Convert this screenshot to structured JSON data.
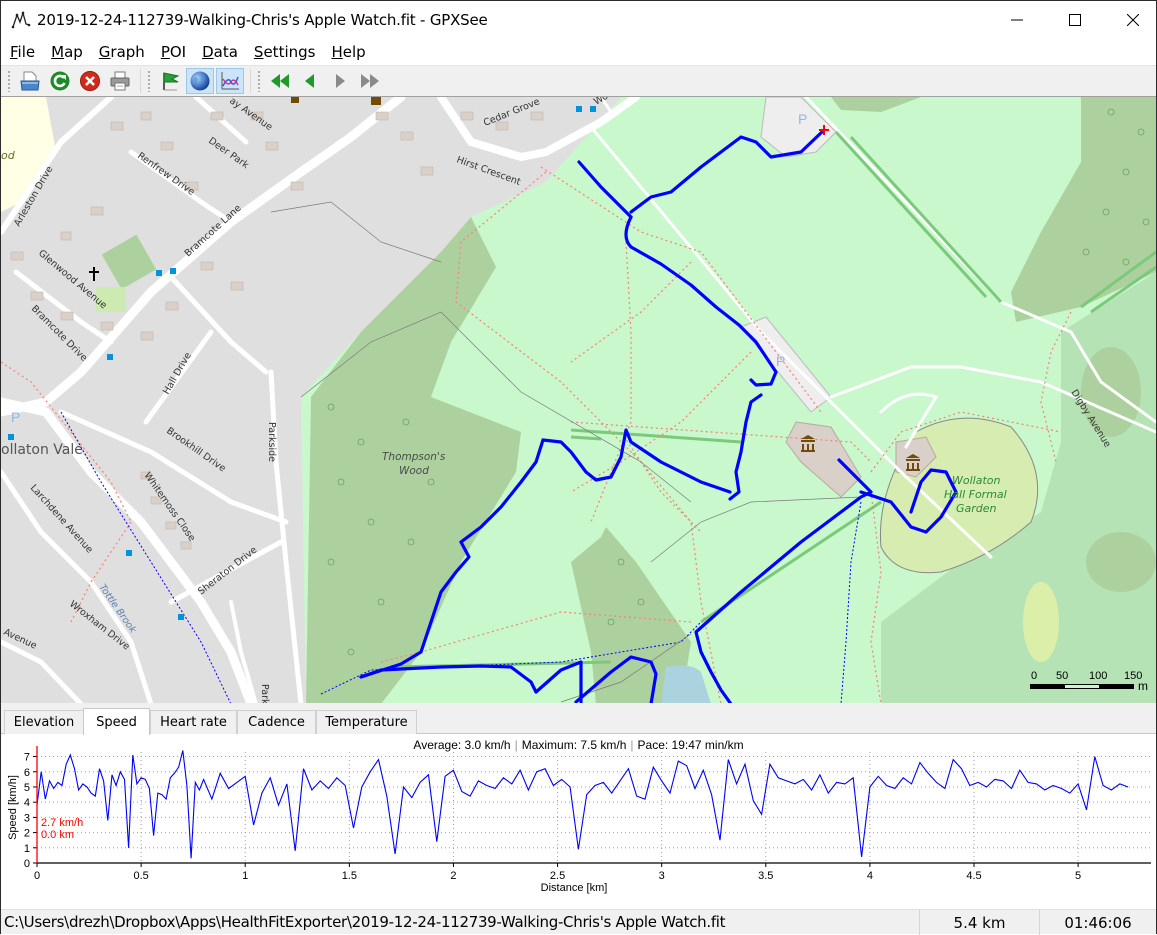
{
  "window": {
    "title": "2019-12-24-112739-Walking-Chris's Apple Watch.fit - GPXSee",
    "app_icon": "gpxsee-track-icon",
    "controls": [
      "minimize",
      "maximize",
      "close"
    ]
  },
  "menu": {
    "items": [
      {
        "label": "File",
        "mnemonic": "F"
      },
      {
        "label": "Map",
        "mnemonic": "M"
      },
      {
        "label": "Graph",
        "mnemonic": "G"
      },
      {
        "label": "POI",
        "mnemonic": "P"
      },
      {
        "label": "Data",
        "mnemonic": "D"
      },
      {
        "label": "Settings",
        "mnemonic": "S"
      },
      {
        "label": "Help",
        "mnemonic": "H"
      }
    ]
  },
  "toolbar": {
    "groups": [
      [
        {
          "name": "open-file",
          "icon": "open-file-icon",
          "checked": false
        },
        {
          "name": "reload",
          "icon": "reload-icon",
          "checked": false
        },
        {
          "name": "close-file",
          "icon": "close-file-icon",
          "checked": false
        },
        {
          "name": "print",
          "icon": "printer-icon",
          "checked": false
        }
      ],
      [
        {
          "name": "show-poi",
          "icon": "flag-icon",
          "checked": false
        },
        {
          "name": "show-map",
          "icon": "globe-icon",
          "checked": true
        },
        {
          "name": "show-graphs",
          "icon": "graph-icon",
          "checked": true
        }
      ],
      [
        {
          "name": "first-file",
          "icon": "first-icon",
          "checked": false,
          "enabled": true
        },
        {
          "name": "previous-file",
          "icon": "previous-icon",
          "checked": false,
          "enabled": true
        },
        {
          "name": "next-file",
          "icon": "next-icon",
          "checked": false,
          "enabled": false
        },
        {
          "name": "last-file",
          "icon": "last-icon",
          "checked": false,
          "enabled": false
        }
      ]
    ]
  },
  "map": {
    "labels": {
      "arleston": "Arleston Drive",
      "renfrew": "Renfrew Drive",
      "deer_park": "Deer Park",
      "ay_avenue": "ay Avenue",
      "bramcote_lane": "Bramcote Lane",
      "glenwood": "Glenwood Avenue",
      "bramcote_drive": "Bramcote Drive",
      "hall_drive": "Hall Drive",
      "wollaton_vale": "ollaton Vale",
      "brookhill": "Brookhill Drive",
      "whitemoss": "Whitemoss Close",
      "parkside": "Parkside",
      "parkside2": "Park",
      "larchdene": "Larchdene Avenue",
      "sheraton": "Sheraton Drive",
      "tottle": "Tottle Brook",
      "wroxham": "Wroxham Drive",
      "avenue_bl": "Avenue",
      "cedar": "Cedar Grove",
      "hirst": "Hirst Crescent",
      "wo": "Wo",
      "thompsons": "Thompson's",
      "wood": "Wood",
      "wollaton_garden_1": "Wollaton",
      "wollaton_garden_2": "Hall Formal",
      "wollaton_garden_3": "Garden",
      "digby": "Digby Avenue",
      "parking": "P",
      "left_partial": "od"
    },
    "scale": {
      "ticks": [
        "0",
        "50",
        "100",
        "150"
      ],
      "unit": "m"
    },
    "track_color": "#0000ff",
    "start_marker_color": "#ff0000"
  },
  "graph_tabs": [
    {
      "label": "Elevation",
      "active": false
    },
    {
      "label": "Speed",
      "active": true
    },
    {
      "label": "Heart rate",
      "active": false
    },
    {
      "label": "Cadence",
      "active": false
    },
    {
      "label": "Temperature",
      "active": false
    }
  ],
  "graph": {
    "info": {
      "average": "Average: 3.0 km/h",
      "maximum": "Maximum: 7.5 km/h",
      "pace": "Pace: 19:47 min/km"
    },
    "slider": {
      "speed": "2.7 km/h",
      "distance": "0.0 km",
      "color": "#ff0000"
    }
  },
  "chart_data": {
    "type": "line",
    "title": "",
    "xlabel": "Distance [km]",
    "ylabel": "Speed [km/h]",
    "xlim": [
      0,
      5.35
    ],
    "ylim": [
      0,
      7.3
    ],
    "x_ticks": [
      "0",
      "0.5",
      "1",
      "1.5",
      "2",
      "2.5",
      "3",
      "3.5",
      "4",
      "4.5",
      "5"
    ],
    "y_ticks": [
      "0",
      "1",
      "2",
      "3",
      "4",
      "5",
      "6",
      "7"
    ],
    "grid": true,
    "series": [
      {
        "name": "Speed",
        "color": "#0000ff",
        "x": [
          0,
          0.02,
          0.04,
          0.06,
          0.08,
          0.1,
          0.12,
          0.14,
          0.16,
          0.18,
          0.2,
          0.22,
          0.24,
          0.26,
          0.28,
          0.3,
          0.32,
          0.34,
          0.36,
          0.38,
          0.4,
          0.42,
          0.44,
          0.46,
          0.48,
          0.5,
          0.52,
          0.54,
          0.56,
          0.58,
          0.6,
          0.62,
          0.64,
          0.66,
          0.68,
          0.7,
          0.72,
          0.74,
          0.76,
          0.78,
          0.8,
          0.84,
          0.88,
          0.92,
          0.96,
          1.0,
          1.04,
          1.08,
          1.12,
          1.16,
          1.2,
          1.24,
          1.28,
          1.32,
          1.36,
          1.4,
          1.44,
          1.48,
          1.52,
          1.56,
          1.6,
          1.64,
          1.68,
          1.72,
          1.76,
          1.8,
          1.84,
          1.88,
          1.92,
          1.96,
          2.0,
          2.04,
          2.08,
          2.12,
          2.16,
          2.2,
          2.24,
          2.28,
          2.32,
          2.36,
          2.4,
          2.44,
          2.48,
          2.52,
          2.56,
          2.6,
          2.64,
          2.68,
          2.72,
          2.76,
          2.8,
          2.84,
          2.88,
          2.92,
          2.96,
          3.0,
          3.04,
          3.08,
          3.12,
          3.16,
          3.2,
          3.24,
          3.28,
          3.32,
          3.36,
          3.4,
          3.44,
          3.48,
          3.52,
          3.56,
          3.6,
          3.64,
          3.68,
          3.72,
          3.76,
          3.8,
          3.84,
          3.88,
          3.92,
          3.96,
          4.0,
          4.04,
          4.08,
          4.12,
          4.16,
          4.2,
          4.24,
          4.28,
          4.32,
          4.36,
          4.4,
          4.44,
          4.48,
          4.52,
          4.56,
          4.6,
          4.64,
          4.68,
          4.72,
          4.76,
          4.8,
          4.84,
          4.88,
          4.92,
          4.96,
          5.0,
          5.04,
          5.08,
          5.12,
          5.16,
          5.2,
          5.24,
          5.28,
          5.32,
          5.35
        ],
        "y": [
          3.8,
          6.0,
          4.2,
          5.4,
          4.9,
          5.3,
          5.1,
          6.5,
          7.1,
          6.2,
          4.8,
          5.2,
          5.0,
          4.6,
          4.4,
          6.2,
          5.4,
          2.8,
          5.8,
          5.1,
          6.0,
          5.5,
          1.0,
          7.1,
          5.2,
          5.6,
          5.5,
          4.9,
          1.8,
          4.6,
          4.5,
          4.2,
          5.6,
          5.9,
          6.3,
          7.4,
          5.1,
          0.3,
          5.3,
          4.8,
          5.5,
          4.2,
          5.9,
          4.9,
          5.3,
          5.7,
          2.5,
          4.6,
          5.6,
          3.8,
          5.2,
          0.8,
          6.2,
          4.8,
          5.4,
          4.9,
          5.6,
          5.1,
          2.3,
          5.0,
          6.0,
          6.8,
          4.4,
          0.6,
          5.0,
          4.3,
          5.3,
          5.8,
          1.4,
          5.7,
          6.1,
          4.7,
          4.4,
          5.4,
          5.1,
          4.9,
          5.6,
          5.2,
          6.1,
          4.8,
          6.0,
          6.2,
          5.1,
          5.5,
          5.0,
          0.9,
          4.5,
          5.1,
          5.3,
          4.6,
          5.4,
          6.2,
          4.4,
          4.2,
          6.3,
          5.4,
          4.6,
          6.7,
          6.4,
          4.9,
          6.1,
          4.5,
          1.5,
          6.8,
          5.2,
          6.5,
          4.1,
          3.2,
          6.5,
          5.6,
          5.4,
          5.2,
          5.5,
          4.8,
          5.8,
          4.6,
          5.3,
          5.2,
          5.6,
          0.4,
          5.0,
          5.7,
          5.1,
          4.9,
          5.6,
          5.2,
          6.6,
          5.9,
          5.3,
          4.9,
          6.8,
          6.2,
          5.1,
          5.3,
          5.0,
          5.5,
          5.4,
          4.9,
          6.1,
          5.3,
          5.2,
          4.8,
          5.1,
          4.9,
          4.6,
          5.2,
          3.5,
          7.0,
          5.1,
          4.8,
          5.2,
          5.0
        ]
      }
    ]
  },
  "statusbar": {
    "path": "C:\\Users\\drezh\\Dropbox\\Apps\\HealthFitExporter\\2019-12-24-112739-Walking-Chris's Apple Watch.fit",
    "distance": "5.4 km",
    "time": "01:46:06"
  }
}
